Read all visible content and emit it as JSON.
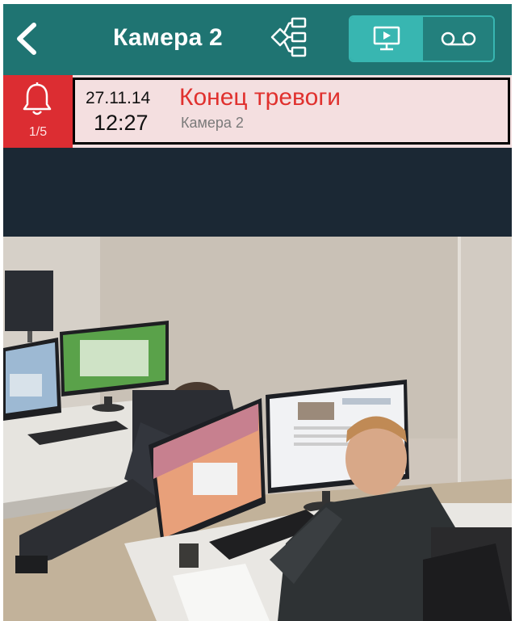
{
  "header": {
    "title": "Камера 2",
    "back_icon": "chevron-left-icon",
    "layout_icon": "camera-tree-icon",
    "modes": [
      {
        "icon": "live-monitor-icon",
        "selected": true
      },
      {
        "icon": "archive-tape-icon",
        "selected": false
      }
    ]
  },
  "alarm": {
    "icon": "bell-icon",
    "counter": "1/5",
    "date": "27.11.14",
    "time": "12:27",
    "event": "Конец тревоги",
    "camera": "Камера 2"
  },
  "colors": {
    "header_bg": "#1f7472",
    "toggle_active": "#38b6b1",
    "alarm_red": "#dc2d32",
    "alarm_bg": "#f4dfe0",
    "event_text": "#e0312e",
    "letterbox": "#1b2834"
  }
}
